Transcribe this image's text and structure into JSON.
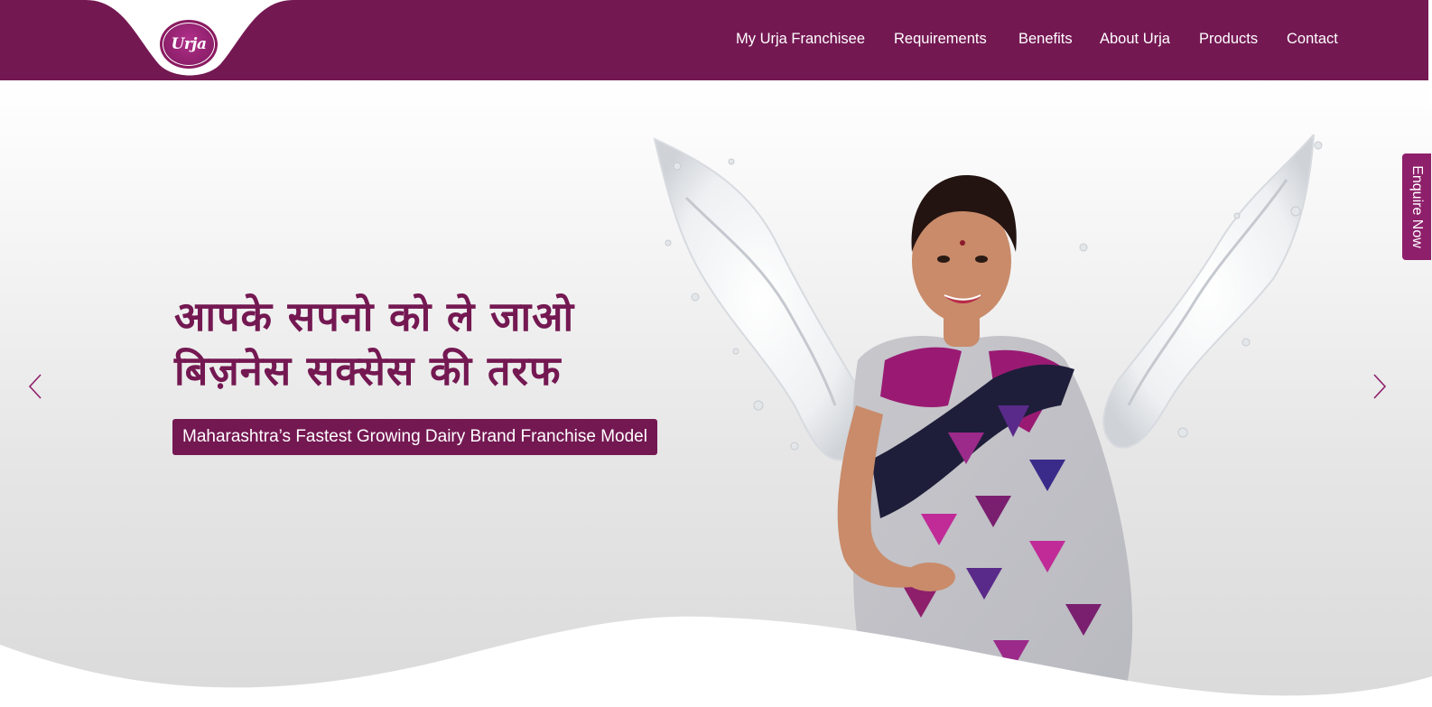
{
  "brand": {
    "logo_text": "Urja",
    "logo_mark": "®",
    "color_primary": "#741852",
    "color_accent": "#8e1f6b"
  },
  "nav": {
    "items": [
      {
        "label": "My Urja Franchisee"
      },
      {
        "label": "Requirements"
      },
      {
        "label": "Benefits"
      },
      {
        "label": "About Urja"
      },
      {
        "label": "Products"
      },
      {
        "label": "Contact"
      }
    ]
  },
  "hero": {
    "headline_line1": "आपके सपनो को ले जाओ",
    "headline_line2": "बिज़नेस सक्सेस की तरफ",
    "tagline": "Maharashtra’s Fastest Growing Dairy Brand Franchise Model",
    "prev_icon": "chevron-left-icon",
    "next_icon": "chevron-right-icon"
  },
  "enquire": {
    "label": "Enquire Now"
  }
}
